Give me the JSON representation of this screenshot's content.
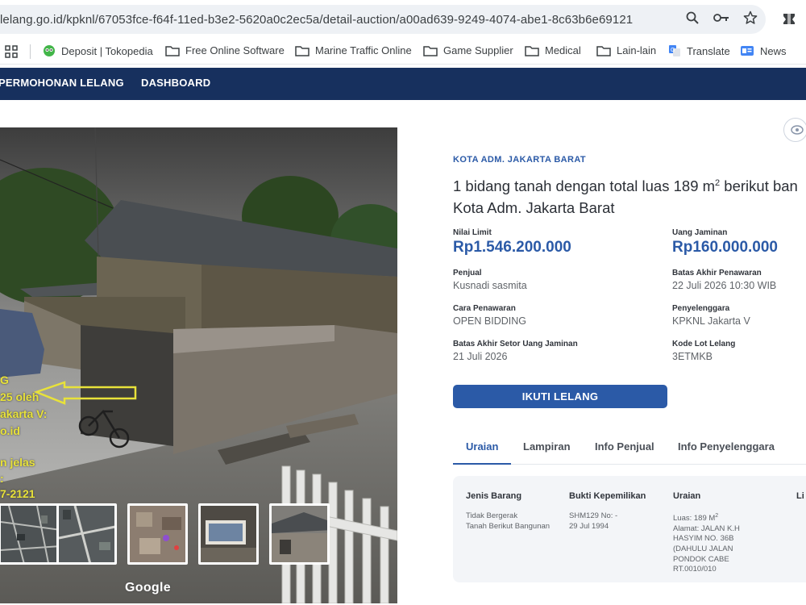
{
  "browser": {
    "url": "lelang.go.id/kpknl/67053fce-f64f-11ed-b3e2-5620a0c2ec5a/detail-auction/a00ad639-9249-4074-abe1-8c63b6e69121",
    "icons": [
      "zoom-icon",
      "key-icon",
      "star-icon",
      "extension-icon"
    ]
  },
  "bookmarks": [
    {
      "label": "Deposit | Tokopedia",
      "icon": "tokopedia-icon"
    },
    {
      "label": "Free Online Software",
      "icon": "folder-icon"
    },
    {
      "label": "Marine Traffic Online",
      "icon": "folder-icon"
    },
    {
      "label": "Game Supplier",
      "icon": "folder-icon"
    },
    {
      "label": "Medical",
      "icon": "folder-icon"
    },
    {
      "label": "Lain-lain",
      "icon": "folder-icon"
    },
    {
      "label": "Translate",
      "icon": "translate-icon"
    },
    {
      "label": "News",
      "icon": "news-icon"
    }
  ],
  "nav": {
    "items": [
      "PERMOHONAN LELANG",
      "DASHBOARD"
    ]
  },
  "photo": {
    "overlay_lines": [
      "G",
      "25 oleh",
      "akarta V:",
      "o.id",
      "n jelas",
      ":",
      "7-2121"
    ],
    "watermark": "Google"
  },
  "auction": {
    "region": "KOTA ADM. JAKARTA BARAT",
    "title_line1_pre": "1 bidang tanah dengan total luas 189 m",
    "title_sup": "2",
    "title_line1_post": " berikut ban",
    "title_line2": "Kota Adm. Jakarta Barat",
    "fields": {
      "nilai_limit": {
        "label": "Nilai Limit",
        "value": "Rp1.546.200.000"
      },
      "uang_jaminan": {
        "label": "Uang Jaminan",
        "value": "Rp160.000.000"
      },
      "penjual": {
        "label": "Penjual",
        "value": "Kusnadi sasmita"
      },
      "batas_penawaran": {
        "label": "Batas Akhir Penawaran",
        "value": "22 Juli 2026 10:30 WIB"
      },
      "cara_penawaran": {
        "label": "Cara Penawaran",
        "value": "OPEN BIDDING"
      },
      "penyelenggara": {
        "label": "Penyelenggara",
        "value": "KPKNL Jakarta V"
      },
      "batas_setor": {
        "label": "Batas Akhir Setor Uang Jaminan",
        "value": "21 Juli 2026"
      },
      "kode_lot": {
        "label": "Kode Lot Lelang",
        "value": "3ETMKB"
      }
    },
    "cta": "IKUTI LELANG"
  },
  "tabs": [
    "Uraian",
    "Lampiran",
    "Info Penjual",
    "Info Penyelenggara"
  ],
  "uraian_table": {
    "headers": [
      "Jenis Barang",
      "Bukti Kepemilikan",
      "Uraian",
      "Li"
    ],
    "jenis_barang": "Tidak Bergerak\nTanah Berikut Bangunan",
    "bukti": "SHM129 No: -\n29 Jul 1994",
    "uraian_pre": "Luas: 189 M",
    "uraian_sup": "2",
    "uraian_rest": "Alamat: JALAN K.H\nHASYIM NO. 36B\n(DAHULU JALAN\nPONDOK CABE\nRT.0010/010"
  }
}
